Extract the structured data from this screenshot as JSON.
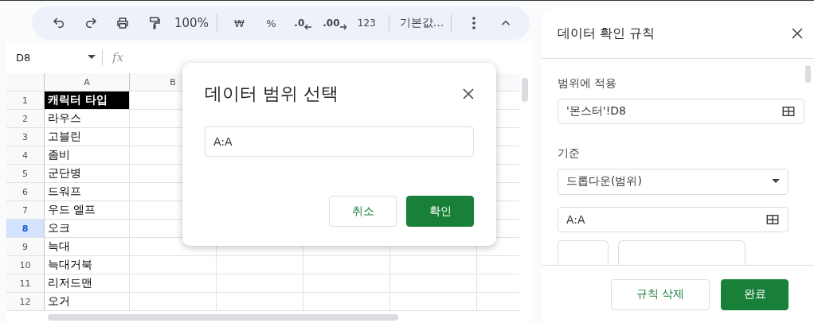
{
  "toolbar": {
    "items": [
      {
        "kind": "undo"
      },
      {
        "kind": "redo"
      },
      {
        "kind": "print"
      },
      {
        "kind": "paint"
      },
      {
        "kind": "zoom",
        "label": "100%"
      },
      {
        "kind": "sep"
      },
      {
        "kind": "text",
        "label": "₩"
      },
      {
        "kind": "text",
        "label": "%"
      },
      {
        "kind": "decdown",
        "label": ".0"
      },
      {
        "kind": "decup",
        "label": ".00"
      },
      {
        "kind": "text",
        "label": "123"
      },
      {
        "kind": "sep"
      },
      {
        "kind": "font",
        "label": "기본값..."
      },
      {
        "kind": "sep"
      },
      {
        "kind": "more"
      },
      {
        "kind": "collapse"
      }
    ]
  },
  "formula_bar": {
    "name_box": "D8",
    "fx": "fx"
  },
  "columns": [
    {
      "label": "A"
    },
    {
      "label": "B"
    }
  ],
  "rows": [
    {
      "number": "1",
      "value": "캐릭터 타입",
      "kind": "header",
      "selected": false
    },
    {
      "number": "2",
      "value": "라우스",
      "kind": "data",
      "selected": false
    },
    {
      "number": "3",
      "value": "고블린",
      "kind": "data",
      "selected": false
    },
    {
      "number": "4",
      "value": "좀비",
      "kind": "data",
      "selected": false
    },
    {
      "number": "5",
      "value": "군단병",
      "kind": "data",
      "selected": false
    },
    {
      "number": "6",
      "value": "드워프",
      "kind": "data",
      "selected": false
    },
    {
      "number": "7",
      "value": "우드 엘프",
      "kind": "data",
      "selected": false
    },
    {
      "number": "8",
      "value": "오크",
      "kind": "data",
      "selected": true
    },
    {
      "number": "9",
      "value": "늑대",
      "kind": "data",
      "selected": false
    },
    {
      "number": "10",
      "value": "늑대거북",
      "kind": "data",
      "selected": false
    },
    {
      "number": "11",
      "value": "리저드맨",
      "kind": "data",
      "selected": false
    },
    {
      "number": "12",
      "value": "오거",
      "kind": "data",
      "selected": false
    }
  ],
  "dialog": {
    "title": "데이터 범위 선택",
    "value": "A:A",
    "cancel": "취소",
    "ok": "확인"
  },
  "panel": {
    "title": "데이터 확인 규칙",
    "range_label": "범위에 적용",
    "range_value": "'몬스터'!D8",
    "criteria_label": "기준",
    "criteria_value": "드롭다운(범위)",
    "source_value": "A:A",
    "delete": "규칙 삭제",
    "done": "완료"
  }
}
